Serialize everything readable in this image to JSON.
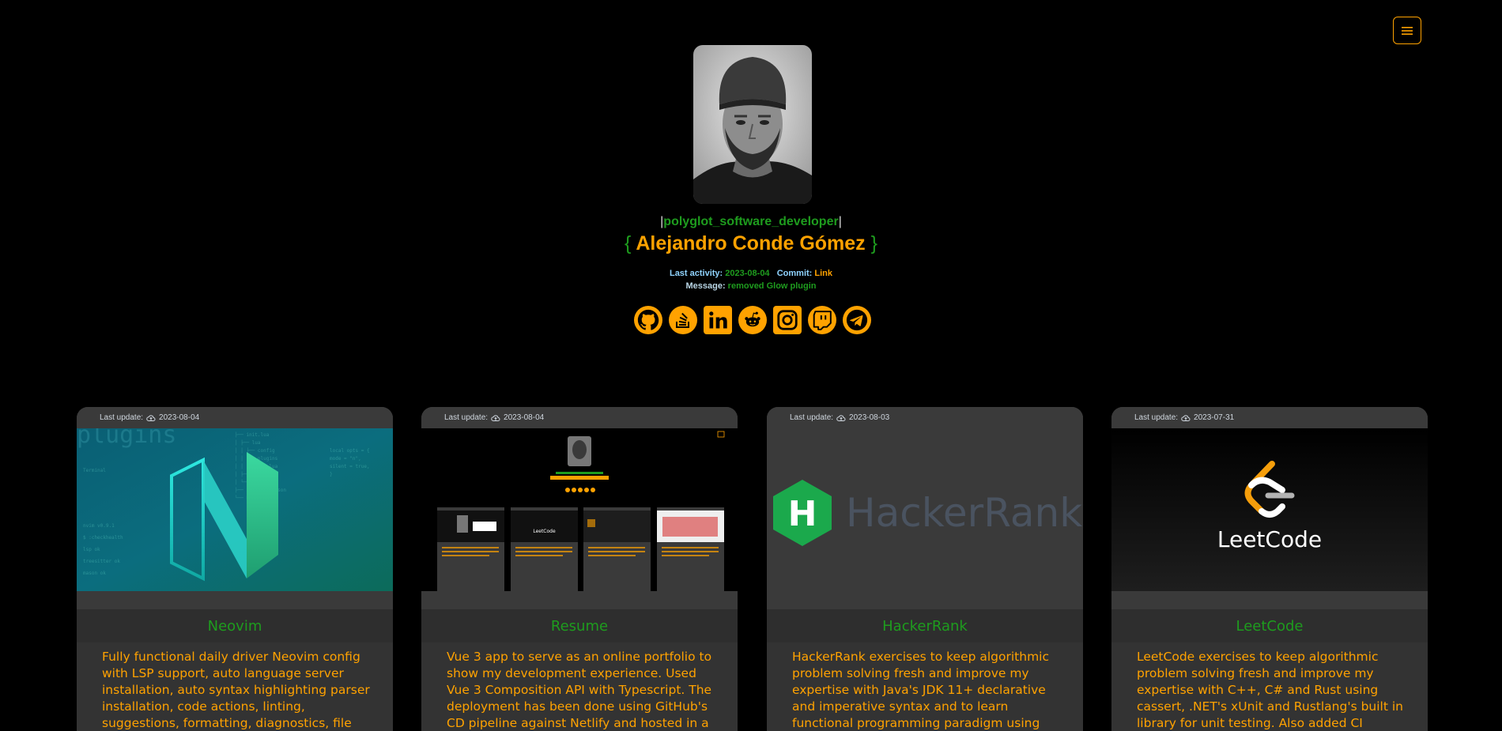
{
  "header": {
    "role": "polyglot_software_developer",
    "role_bar_left": "|",
    "role_bar_right": "|",
    "brace_open": "{",
    "name": "Alejandro Conde Gómez",
    "brace_close": "}"
  },
  "activity": {
    "last_activity_label": "Last activity:",
    "last_activity_value": "2023-08-04",
    "commit_label": "Commit:",
    "commit_link": "Link",
    "message_label": "Message:",
    "message_value": "removed Glow plugin"
  },
  "socials": [
    {
      "name": "github-icon"
    },
    {
      "name": "stackoverflow-icon"
    },
    {
      "name": "linkedin-icon"
    },
    {
      "name": "reddit-icon"
    },
    {
      "name": "instagram-icon"
    },
    {
      "name": "twitch-icon"
    },
    {
      "name": "telegram-icon"
    }
  ],
  "cards": [
    {
      "last_update_label": "Last update:",
      "date": "2023-08-04",
      "title": "Neovim",
      "description": "Fully functional daily driver Neovim config with LSP support, auto language server installation, auto syntax highlighting parser installation, code actions, linting, suggestions, formatting, diagnostics, file search, live grep, file tree, git"
    },
    {
      "last_update_label": "Last update:",
      "date": "2023-08-04",
      "title": "Resume",
      "description": "Vue 3 app to serve as an online portfolio to show my development experience. Used Vue 3 Composition API with Typescript. The deployment has been done using GitHub's CD pipeline against Netlify and hosted in a"
    },
    {
      "last_update_label": "Last update:",
      "date": "2023-08-03",
      "title": "HackerRank",
      "logo_letter": "H",
      "logo_text": "HackerRank",
      "description": "HackerRank exercises to keep algorithmic problem solving fresh and improve my expertise with Java's JDK 11+ declarative and imperative syntax and to learn functional programming paradigm using Haskell. Coded"
    },
    {
      "last_update_label": "Last update:",
      "date": "2023-07-31",
      "title": "LeetCode",
      "logo_text": "LeetCode",
      "description": "LeetCode exercises to keep algorithmic problem solving fresh and improve my expertise with C++, C# and Rust using cassert, .NET's xUnit and Rustlang's built in library for unit testing. Also added CI pipelines for each"
    }
  ],
  "colors": {
    "accent": "#ffa200",
    "green": "#1e9c1e",
    "background": "#000000",
    "card": "#3a3a3a"
  }
}
